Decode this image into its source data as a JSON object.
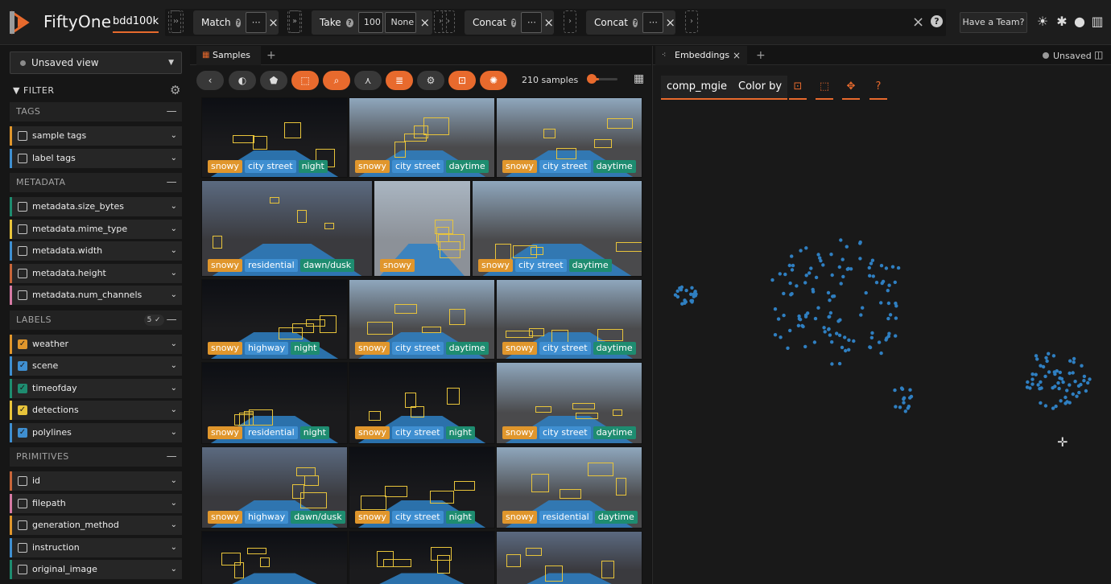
{
  "app": {
    "name": "FiftyOne",
    "dataset": "bdd100k",
    "brand_color": "#e86a2d"
  },
  "stages": [
    {
      "label": "Match",
      "has_help": true,
      "boxes": [
        "⋯"
      ]
    },
    {
      "label": "Take",
      "has_help": true,
      "boxes": [
        "100",
        "None"
      ]
    },
    {
      "label": "Concat",
      "has_help": true,
      "boxes": [
        "⋯"
      ]
    },
    {
      "label": "Concat",
      "has_help": true,
      "boxes": [
        "⋯"
      ]
    }
  ],
  "header": {
    "team_button": "Have a Team?",
    "icons": [
      "light-mode-icon",
      "slack-icon",
      "github-icon",
      "docs-icon"
    ]
  },
  "sidebar": {
    "view": "Unsaved view",
    "filter_label": "FILTER",
    "sections": [
      {
        "name": "TAGS",
        "badge": "",
        "rows": [
          {
            "label": "sample tags",
            "color": "#e0962c",
            "checked": false
          },
          {
            "label": "label tags",
            "color": "#3f8fd1",
            "checked": false
          }
        ]
      },
      {
        "name": "METADATA",
        "badge": "",
        "rows": [
          {
            "label": "metadata.size_bytes",
            "color": "#1e8c70",
            "checked": false
          },
          {
            "label": "metadata.mime_type",
            "color": "#e8c43b",
            "checked": false
          },
          {
            "label": "metadata.width",
            "color": "#3f8fd1",
            "checked": false
          },
          {
            "label": "metadata.height",
            "color": "#c8663a",
            "checked": false
          },
          {
            "label": "metadata.num_channels",
            "color": "#d67aa4",
            "checked": false
          }
        ]
      },
      {
        "name": "LABELS",
        "badge": "5 ✓",
        "rows": [
          {
            "label": "weather",
            "color": "#e0962c",
            "checked": true
          },
          {
            "label": "scene",
            "color": "#3f8fd1",
            "checked": true
          },
          {
            "label": "timeofday",
            "color": "#1e8c70",
            "checked": true
          },
          {
            "label": "detections",
            "color": "#e8c43b",
            "checked": true
          },
          {
            "label": "polylines",
            "color": "#3f8fd1",
            "checked": true
          }
        ]
      },
      {
        "name": "PRIMITIVES",
        "badge": "",
        "rows": [
          {
            "label": "id",
            "color": "#c8663a",
            "checked": false
          },
          {
            "label": "filepath",
            "color": "#d67aa4",
            "checked": false
          },
          {
            "label": "generation_method",
            "color": "#e0962c",
            "checked": false
          },
          {
            "label": "instruction",
            "color": "#3f8fd1",
            "checked": false
          },
          {
            "label": "original_image",
            "color": "#1e8c70",
            "checked": false
          }
        ]
      }
    ]
  },
  "samples_panel": {
    "tab_label": "Samples",
    "sample_count": "210 samples",
    "zoom_level": 0.35,
    "tiles": [
      {
        "tags": [
          "snowy",
          "city street",
          "night"
        ],
        "kind": "night"
      },
      {
        "tags": [
          "snowy",
          "city street",
          "daytime"
        ],
        "kind": "day"
      },
      {
        "tags": [
          "snowy",
          "city street",
          "daytime"
        ],
        "kind": "day"
      },
      {
        "tags": [
          "snowy",
          "residential",
          "dawn/dusk"
        ],
        "kind": "dusk"
      },
      {
        "tags": [
          "snowy"
        ],
        "kind": "fog"
      },
      {
        "tags": [
          "snowy",
          "city street",
          "daytime"
        ],
        "kind": "day"
      },
      {
        "tags": [
          "snowy",
          "highway",
          "night"
        ],
        "kind": "night"
      },
      {
        "tags": [
          "snowy",
          "city street",
          "daytime"
        ],
        "kind": "day"
      },
      {
        "tags": [
          "snowy",
          "city street",
          "daytime"
        ],
        "kind": "day"
      },
      {
        "tags": [
          "snowy",
          "residential",
          "night"
        ],
        "kind": "night"
      },
      {
        "tags": [
          "snowy",
          "city street",
          "night"
        ],
        "kind": "night"
      },
      {
        "tags": [
          "snowy",
          "city street",
          "daytime"
        ],
        "kind": "day"
      },
      {
        "tags": [
          "snowy",
          "highway",
          "dawn/dusk"
        ],
        "kind": "dusk"
      },
      {
        "tags": [
          "snowy",
          "city street",
          "night"
        ],
        "kind": "night"
      },
      {
        "tags": [
          "snowy",
          "residential",
          "daytime"
        ],
        "kind": "day"
      },
      {
        "tags": [],
        "kind": "night"
      },
      {
        "tags": [],
        "kind": "night"
      },
      {
        "tags": [],
        "kind": "dusk"
      }
    ]
  },
  "embeddings_panel": {
    "tab_label": "Embeddings",
    "brain_key": "comp_mgie",
    "color_by": "Color by",
    "unsaved": "Unsaved",
    "point_color": "#2f7fc1"
  }
}
